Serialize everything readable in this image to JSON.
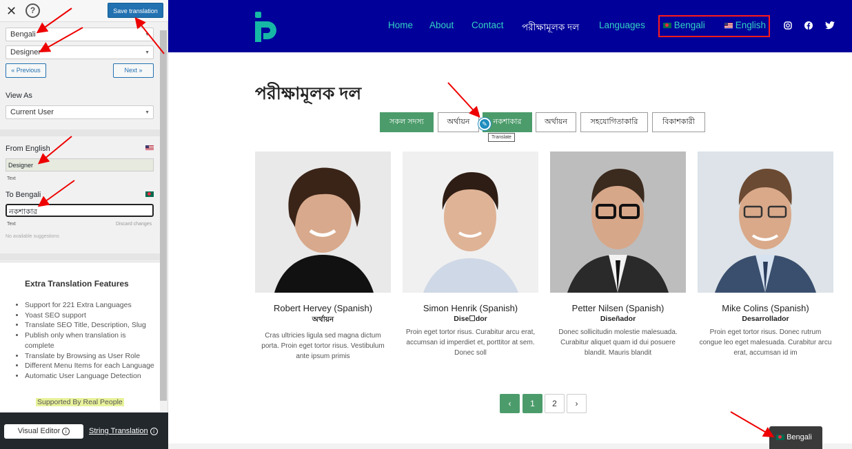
{
  "editor": {
    "save_label": "Save translation",
    "language_select": "Bengali",
    "string_select": "Designer",
    "prev_label": "« Previous",
    "next_label": "Next »",
    "view_as_label": "View As",
    "view_as_value": "Current User",
    "from_label": "From English",
    "source_text": "Designer",
    "source_type": "Text",
    "to_label": "To Bengali",
    "translated_text": "নকশাকার",
    "target_type": "Text",
    "discard_label": "Discard changes",
    "no_suggestions": "No available suggestions",
    "features_title": "Extra Translation Features",
    "features": [
      "Support for 221 Extra Languages",
      "Yoast SEO support",
      "Translate SEO Title, Description, Slug",
      "Publish only when translation is complete",
      "Translate by Browsing as User Role",
      "Different Menu Items for each Language",
      "Automatic User Language Detection"
    ],
    "supported_label": "Supported By Real People",
    "visual_editor_label": "Visual Editor",
    "string_translation_label": "String Translation"
  },
  "site": {
    "menu": [
      "Home",
      "About",
      "Contact",
      "পরীক্ষামূলক দল",
      "Languages"
    ],
    "lang_bengali": "Bengali",
    "lang_english": "English",
    "page_title": "পরীক্ষামূলক দল",
    "filters": [
      "সকল সদস্য",
      "অর্থায়ন",
      "নকশাকার",
      "অর্থায়ন",
      "সহযোগিতাকারি",
      "বিকাশকারী"
    ],
    "tooltip": "Translate",
    "team": [
      {
        "name": "Robert Hervey (Spanish)",
        "role": "অর্থায়ন",
        "desc": "Cras ultricies ligula sed magna dictum porta. Proin eget tortor risus. Vestibulum ante ipsum primis"
      },
      {
        "name": "Simon Henrik (Spanish)",
        "role": "Dise☐dor",
        "desc": "Proin eget tortor risus. Curabitur arcu erat, accumsan id imperdiet et, porttitor at sem. Donec soll"
      },
      {
        "name": "Petter Nilsen (Spanish)",
        "role": "Diseñador",
        "desc": "Donec sollicitudin molestie malesuada. Curabitur aliquet quam id dui posuere blandit. Mauris blandit"
      },
      {
        "name": "Mike Colins (Spanish)",
        "role": "Desarrollador",
        "desc": "Proin eget tortor risus. Donec rutrum congue leo eget malesuada. Curabitur arcu erat, accumsan id im"
      }
    ],
    "pagination": [
      "‹",
      "1",
      "2",
      "›"
    ],
    "floating_lang": "Bengali"
  }
}
